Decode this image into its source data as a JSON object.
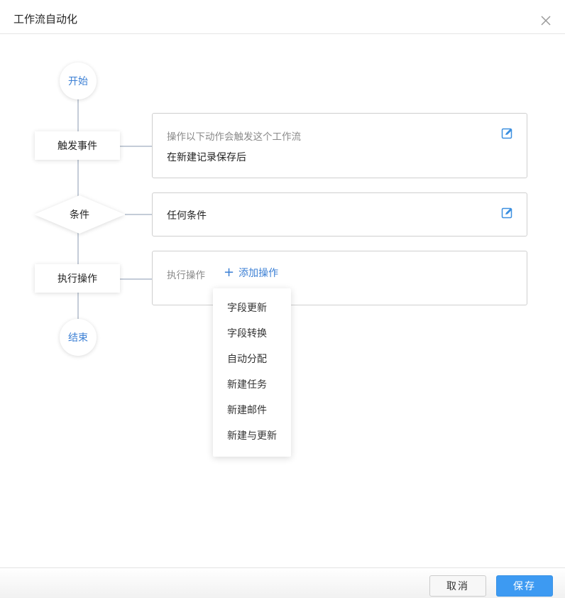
{
  "dialog": {
    "title": "工作流自动化",
    "close_icon": "close-icon"
  },
  "flow": {
    "start_label": "开始",
    "trigger_label": "触发事件",
    "condition_label": "条件",
    "action_label": "执行操作",
    "end_label": "结束"
  },
  "trigger_card": {
    "description": "操作以下动作会触发这个工作流",
    "value": "在新建记录保存后",
    "edit_icon": "edit-icon"
  },
  "condition_card": {
    "value": "任何条件",
    "edit_icon": "edit-icon"
  },
  "action_card": {
    "label": "执行操作",
    "add_label": "添加操作",
    "add_icon": "plus-icon"
  },
  "action_menu": {
    "items": [
      {
        "label": "字段更新"
      },
      {
        "label": "字段转换"
      },
      {
        "label": "自动分配"
      },
      {
        "label": "新建任务"
      },
      {
        "label": "新建邮件"
      },
      {
        "label": "新建与更新"
      }
    ]
  },
  "footer": {
    "cancel_label": "取消",
    "save_label": "保存"
  },
  "colors": {
    "accent": "#3b7fd4",
    "save_button": "#3d9af2",
    "connector": "#c4ccd8"
  }
}
